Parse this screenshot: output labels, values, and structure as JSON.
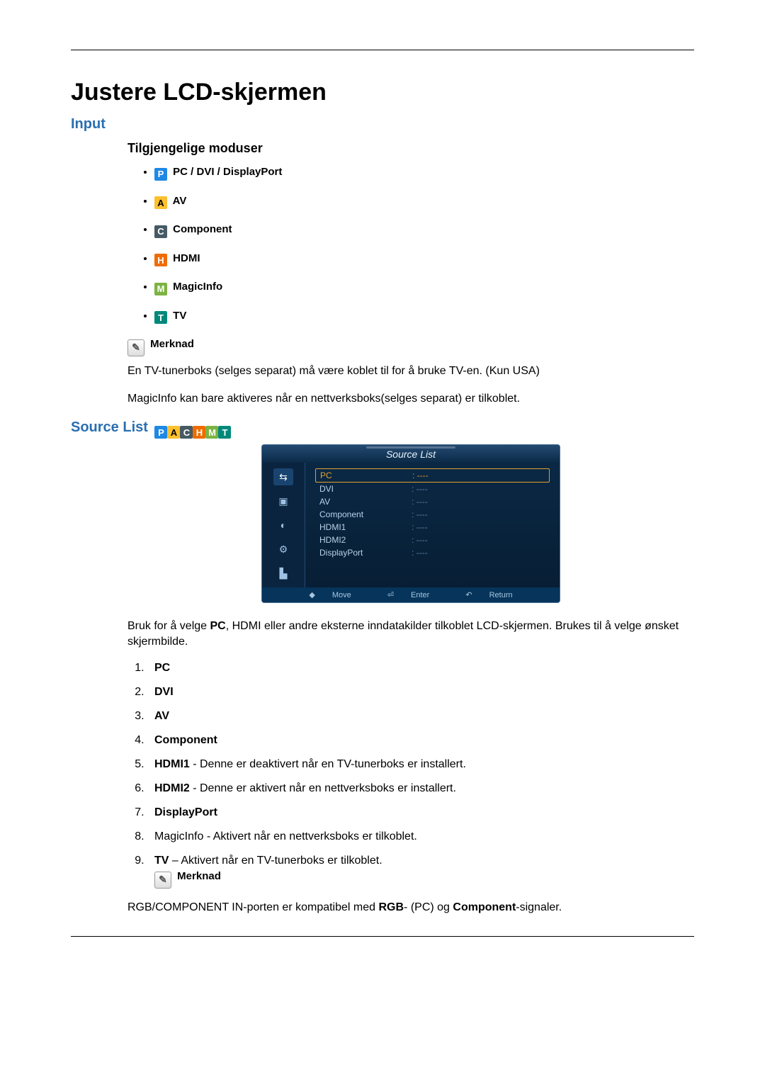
{
  "title": "Justere LCD-skjermen",
  "input_heading": "Input",
  "modes_heading": "Tilgjengelige moduser",
  "modes": {
    "pc": "PC / DVI / DisplayPort",
    "av": "AV",
    "component": "Component",
    "hdmi": "HDMI",
    "magicinfo": "MagicInfo",
    "tv": "TV"
  },
  "note_label": "Merknad",
  "note_1": "En TV-tunerboks (selges separat) må være koblet til for å bruke TV-en. (Kun USA)",
  "note_2": "MagicInfo kan bare aktiveres når en nettverksboks(selges separat) er tilkoblet.",
  "source_list_heading": "Source List",
  "osd": {
    "title": "Source List",
    "items": [
      {
        "name": "PC",
        "value": "----",
        "selected": true
      },
      {
        "name": "DVI",
        "value": "----"
      },
      {
        "name": "AV",
        "value": "----"
      },
      {
        "name": "Component",
        "value": "----"
      },
      {
        "name": "HDMI1",
        "value": "----"
      },
      {
        "name": "HDMI2",
        "value": "----"
      },
      {
        "name": "DisplayPort",
        "value": "----"
      }
    ],
    "foot_move": "Move",
    "foot_enter": "Enter",
    "foot_return": "Return"
  },
  "source_desc_pre": "Bruk for å velge ",
  "source_desc_bold": "PC",
  "source_desc_post": ", HDMI eller andre eksterne inndatakilder tilkoblet LCD-skjermen. Brukes til å velge ønsket skjermbilde.",
  "sources": {
    "1": {
      "bold": "PC"
    },
    "2": {
      "bold": "DVI"
    },
    "3": {
      "bold": "AV"
    },
    "4": {
      "bold": "Component"
    },
    "5": {
      "bold": "HDMI1",
      "rest": " - Denne er deaktivert når en TV-tunerboks er installert."
    },
    "6": {
      "bold": "HDMI2",
      "rest": " - Denne er aktivert når en nettverksboks er installert."
    },
    "7": {
      "bold": "DisplayPort"
    },
    "8": {
      "text": "MagicInfo - Aktivert når en nettverksboks er tilkoblet."
    },
    "9": {
      "bold": "TV",
      "rest": " – Aktivert når en TV-tunerboks er tilkoblet."
    }
  },
  "note_label_2": "Merknad",
  "note_3_pre": "RGB/COMPONENT IN-porten er kompatibel med ",
  "note_3_b1": "RGB",
  "note_3_mid": "- (PC) og ",
  "note_3_b2": "Component",
  "note_3_post": "-signaler."
}
